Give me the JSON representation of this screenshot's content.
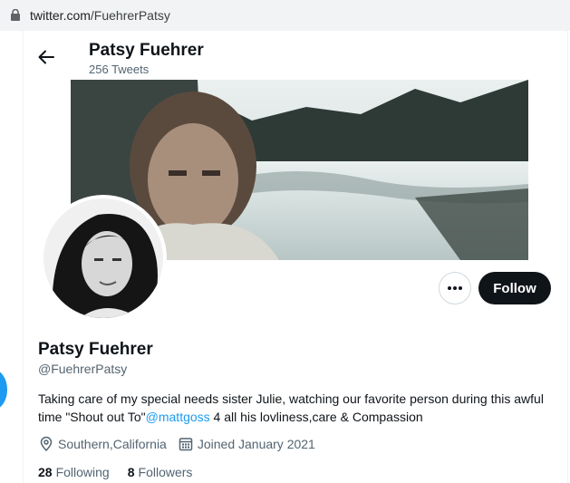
{
  "browser": {
    "url_host": "twitter.com",
    "url_path": "/FuehrerPatsy"
  },
  "header": {
    "name": "Patsy Fuehrer",
    "tweet_count": "256 Tweets"
  },
  "actions": {
    "follow_label": "Follow"
  },
  "profile": {
    "name": "Patsy Fuehrer",
    "handle": "@FuehrerPatsy",
    "bio_before": "Taking care of my special needs sister Julie, watching our favorite person during this awful time \"Shout out To\"",
    "bio_mention": "@mattgoss",
    "bio_after": " 4 all his lovliness,care & Compassion",
    "location": "Southern,California",
    "joined": "Joined January 2021",
    "following_count": "28",
    "following_label": "Following",
    "followers_count": "8",
    "followers_label": "Followers"
  },
  "icons": {
    "lock": "lock-icon",
    "back": "back-arrow-icon",
    "more": "more-dots-icon",
    "location": "location-pin-icon",
    "calendar": "calendar-icon"
  },
  "colors": {
    "accent": "#1d9bf0",
    "text": "#0f1419",
    "muted": "#536471"
  }
}
